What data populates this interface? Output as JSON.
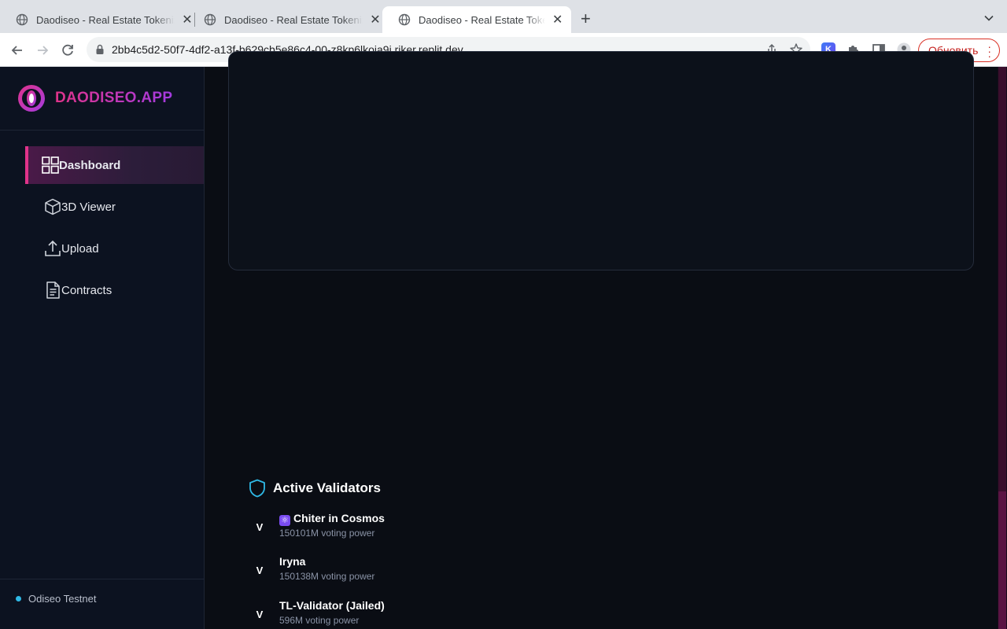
{
  "browser": {
    "tabs": [
      {
        "title": "Daodiseo - Real Estate Tokenization",
        "active": false
      },
      {
        "title": "Daodiseo - Real Estate Tokenization",
        "active": false
      },
      {
        "title": "Daodiseo - Real Estate Tokenization",
        "active": true
      }
    ],
    "url": "2bb4c5d2-50f7-4df2-a13f-b629cb5e86c4-00-z8kp6lkoia9j.riker.replit.dev",
    "extension_letter": "K",
    "update_label": "Обновить"
  },
  "sidebar": {
    "brand": "DAODISEO.APP",
    "items": [
      {
        "label": "Dashboard",
        "icon": "grid-icon",
        "active": true
      },
      {
        "label": "3D Viewer",
        "icon": "cube-icon",
        "active": false
      },
      {
        "label": "Upload",
        "icon": "upload-icon",
        "active": false
      },
      {
        "label": "Contracts",
        "icon": "document-icon",
        "active": false
      }
    ],
    "network": "Odiseo Testnet"
  },
  "validators": {
    "title": "Active Validators",
    "rows": [
      {
        "avatar": "V",
        "name": "Chiter in Cosmos",
        "emoji": "⚛",
        "power": "150101M voting power"
      },
      {
        "avatar": "V",
        "name": "Iryna",
        "emoji": "",
        "power": "150138M voting power"
      },
      {
        "avatar": "V",
        "name": "TL-Validator (Jailed)",
        "emoji": "",
        "power": "596M voting power"
      }
    ]
  },
  "colors": {
    "accent_pink": "#e0338a",
    "accent_purple": "#a43be0",
    "status_dot": "#2fb9e6",
    "background": "#0a0d14",
    "sidebar": "#0c1220"
  }
}
